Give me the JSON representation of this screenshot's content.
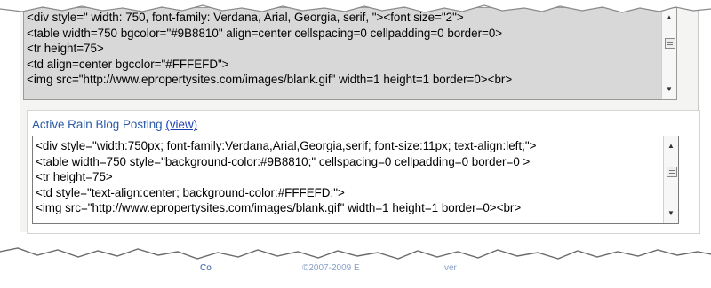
{
  "top_partial_line": "<div style=\" width: 750, font-family: Verdana, Arial, Georgia, serif, \"><font size=\"2\">",
  "original_code_lines": [
    "<table width=750 bgcolor=\"#9B8810\" align=center cellspacing=0 cellpadding=0 border=0>",
    "<tr height=75>",
    "<td align=center bgcolor=\"#FFFEFD\">",
    "<img src=\"http://www.epropertysites.com/images/blank.gif\" width=1 height=1 border=0><br>"
  ],
  "section": {
    "title": "Active Rain Blog Posting",
    "view_link": "(view)"
  },
  "converted_code_lines": [
    "<div style=\"width:750px; font-family:Verdana,Arial,Georgia,serif; font-size:11px; text-align:left;\">",
    "<table width=750 style=\"background-color:#9B8810;\" cellspacing=0 cellpadding=0 border=0 >",
    "<tr height=75>",
    "<td style=\"text-align:center; background-color:#FFFEFD;\">",
    "<img src=\"http://www.epropertysites.com/images/blank.gif\" width=1 height=1 border=0><br>"
  ],
  "footer_fragments": [
    "Co",
    "©2007-2009 E",
    "ver"
  ]
}
